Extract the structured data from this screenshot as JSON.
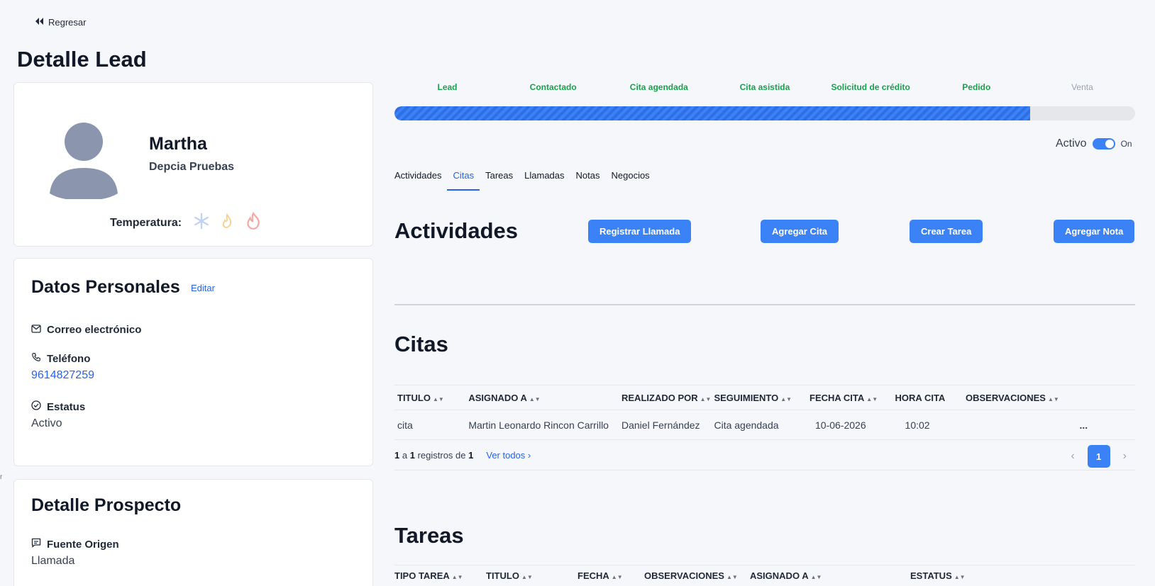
{
  "nav": {
    "back_label": "Regresar"
  },
  "page_title": "Detalle Lead",
  "profile": {
    "name": "Martha",
    "company": "Depcia Pruebas",
    "temperature_label": "Temperatura:",
    "temperature_icons": [
      "snowflake-icon",
      "flame-small-icon",
      "fire-icon"
    ]
  },
  "personal": {
    "title": "Datos Personales",
    "edit_label": "Editar",
    "email_label": "Correo electrónico",
    "email_value": "",
    "phone_label": "Teléfono",
    "phone_value": "9614827259",
    "status_label": "Estatus",
    "status_value": "Activo"
  },
  "prospect": {
    "title": "Detalle Prospecto",
    "source_label": "Fuente Origen",
    "source_value": "Llamada"
  },
  "pipeline": {
    "steps": [
      "Lead",
      "Contactado",
      "Cita agendada",
      "Cita asistida",
      "Solicitud de crédito",
      "Pedido",
      "Venta"
    ],
    "completed_steps": 6,
    "progress_fraction": 0.858,
    "colors": {
      "done": "#16a34a",
      "pending": "#9ca3af",
      "bar": "#3b82f6"
    }
  },
  "toggle": {
    "label": "Activo",
    "state": "On"
  },
  "tabs": [
    "Actividades",
    "Citas",
    "Tareas",
    "Llamadas",
    "Notas",
    "Negocios"
  ],
  "active_tab": "Citas",
  "activities": {
    "title": "Actividades",
    "buttons": {
      "call": "Registrar Llamada",
      "appointment": "Agregar Cita",
      "task": "Crear Tarea",
      "note": "Agregar Nota"
    }
  },
  "citas": {
    "title": "Citas",
    "columns": [
      "TITULO",
      "ASIGNADO A",
      "REALIZADO POR",
      "SEGUIMIENTO",
      "FECHA CITA",
      "HORA CITA",
      "OBSERVACIONES"
    ],
    "rows": [
      {
        "titulo": "cita",
        "asignado": "Martin Leonardo Rincon Carrillo",
        "realizado": "Daniel Fernández",
        "seguimiento": "Cita agendada",
        "fecha": "10-06-2026",
        "hora": "10:02",
        "observaciones": "",
        "actions": "..."
      }
    ],
    "footer": {
      "from": "1",
      "a": "a",
      "to": "1",
      "registros": "registros de",
      "total": "1",
      "see_all": "Ver todos"
    },
    "pagination": {
      "current_page": "1"
    }
  },
  "tareas": {
    "title": "Tareas",
    "columns": [
      "TIPO TAREA",
      "TITULO",
      "FECHA",
      "OBSERVACIONES",
      "ASIGNADO A",
      "ESTATUS"
    ]
  },
  "accent_color": "#3b82f6"
}
